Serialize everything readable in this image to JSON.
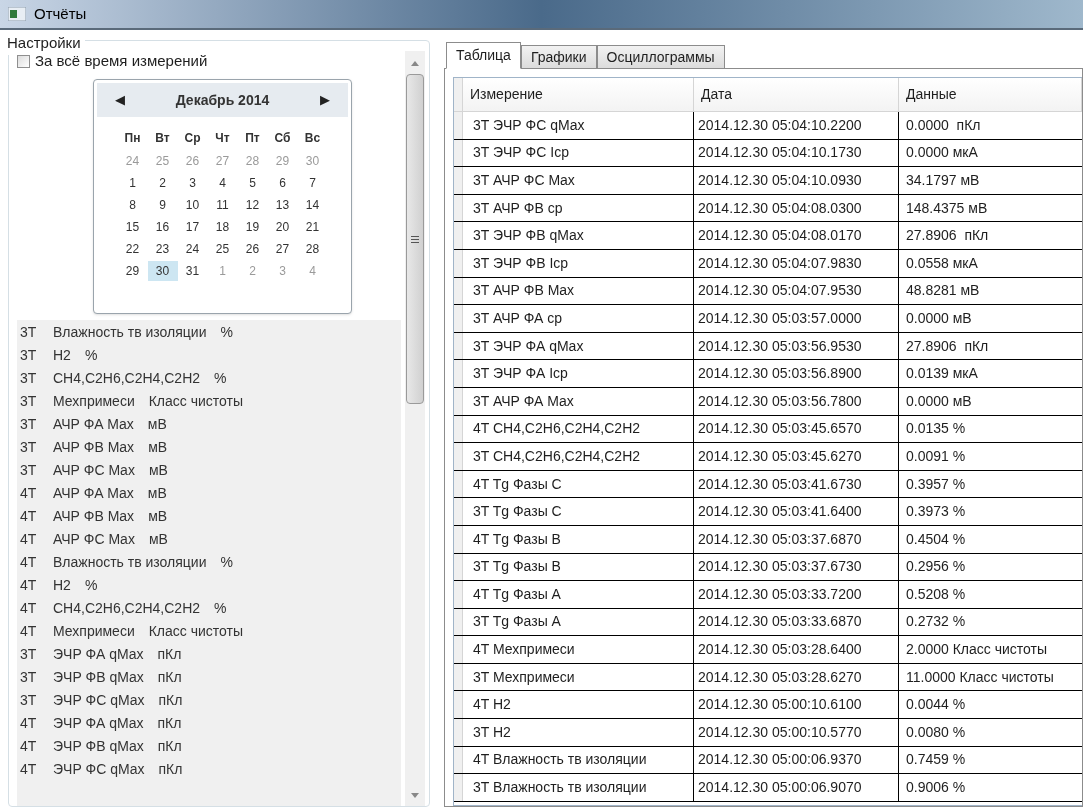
{
  "window": {
    "title": "Отчёты"
  },
  "settings": {
    "title": "Настройки",
    "all_time": {
      "label": "За всё время измерений",
      "checked": false
    },
    "calendar": {
      "month": "Декабрь 2014",
      "prev": "◀",
      "next": "▶",
      "weekdays": [
        "Пн",
        "Вт",
        "Ср",
        "Чт",
        "Пт",
        "Сб",
        "Вс"
      ],
      "weeks": [
        [
          {
            "d": "24",
            "other": true,
            "selected": false
          },
          {
            "d": "25",
            "other": true,
            "selected": false
          },
          {
            "d": "26",
            "other": true,
            "selected": false
          },
          {
            "d": "27",
            "other": true,
            "selected": false
          },
          {
            "d": "28",
            "other": true,
            "selected": false
          },
          {
            "d": "29",
            "other": true,
            "selected": false
          },
          {
            "d": "30",
            "other": true,
            "selected": false
          }
        ],
        [
          {
            "d": "1",
            "other": false,
            "selected": false
          },
          {
            "d": "2",
            "other": false,
            "selected": false
          },
          {
            "d": "3",
            "other": false,
            "selected": false
          },
          {
            "d": "4",
            "other": false,
            "selected": false
          },
          {
            "d": "5",
            "other": false,
            "selected": false
          },
          {
            "d": "6",
            "other": false,
            "selected": false
          },
          {
            "d": "7",
            "other": false,
            "selected": false
          }
        ],
        [
          {
            "d": "8",
            "other": false,
            "selected": false
          },
          {
            "d": "9",
            "other": false,
            "selected": false
          },
          {
            "d": "10",
            "other": false,
            "selected": false
          },
          {
            "d": "11",
            "other": false,
            "selected": false
          },
          {
            "d": "12",
            "other": false,
            "selected": false
          },
          {
            "d": "13",
            "other": false,
            "selected": false
          },
          {
            "d": "14",
            "other": false,
            "selected": false
          }
        ],
        [
          {
            "d": "15",
            "other": false,
            "selected": false
          },
          {
            "d": "16",
            "other": false,
            "selected": false
          },
          {
            "d": "17",
            "other": false,
            "selected": false
          },
          {
            "d": "18",
            "other": false,
            "selected": false
          },
          {
            "d": "19",
            "other": false,
            "selected": false
          },
          {
            "d": "20",
            "other": false,
            "selected": false
          },
          {
            "d": "21",
            "other": false,
            "selected": false
          }
        ],
        [
          {
            "d": "22",
            "other": false,
            "selected": false
          },
          {
            "d": "23",
            "other": false,
            "selected": false
          },
          {
            "d": "24",
            "other": false,
            "selected": false
          },
          {
            "d": "25",
            "other": false,
            "selected": false
          },
          {
            "d": "26",
            "other": false,
            "selected": false
          },
          {
            "d": "27",
            "other": false,
            "selected": false
          },
          {
            "d": "28",
            "other": false,
            "selected": false
          }
        ],
        [
          {
            "d": "29",
            "other": false,
            "selected": false
          },
          {
            "d": "30",
            "other": false,
            "selected": true
          },
          {
            "d": "31",
            "other": false,
            "selected": false
          },
          {
            "d": "1",
            "other": true,
            "selected": false
          },
          {
            "d": "2",
            "other": true,
            "selected": false
          },
          {
            "d": "3",
            "other": true,
            "selected": false
          },
          {
            "d": "4",
            "other": true,
            "selected": false
          }
        ]
      ]
    },
    "parameters": [
      {
        "unit_no": "3T",
        "name": "Влажность тв изоляции",
        "unit": "%"
      },
      {
        "unit_no": "3T",
        "name": "H2",
        "unit": "%"
      },
      {
        "unit_no": "3T",
        "name": "CH4,C2H6,C2H4,C2H2",
        "unit": "%"
      },
      {
        "unit_no": "3T",
        "name": "Мехпримеси",
        "unit": "Класс чистоты"
      },
      {
        "unit_no": "3T",
        "name": "АЧР ФА Max",
        "unit": "мВ"
      },
      {
        "unit_no": "3T",
        "name": "АЧР ФВ Max",
        "unit": "мВ"
      },
      {
        "unit_no": "3T",
        "name": "АЧР ФС Max",
        "unit": "мВ"
      },
      {
        "unit_no": "4T",
        "name": "АЧР ФА Max",
        "unit": "мВ"
      },
      {
        "unit_no": "4T",
        "name": "АЧР ФВ Max",
        "unit": "мВ"
      },
      {
        "unit_no": "4T",
        "name": "АЧР ФС Max",
        "unit": "мВ"
      },
      {
        "unit_no": "4T",
        "name": "Влажность тв изоляции",
        "unit": "%"
      },
      {
        "unit_no": "4T",
        "name": "H2",
        "unit": "%"
      },
      {
        "unit_no": "4T",
        "name": "CH4,C2H6,C2H4,C2H2",
        "unit": "%"
      },
      {
        "unit_no": "4T",
        "name": "Мехпримеси",
        "unit": "Класс чистоты"
      },
      {
        "unit_no": "3T",
        "name": "ЭЧР ФА qMax",
        "unit": "пКл"
      },
      {
        "unit_no": "3T",
        "name": "ЭЧР ФВ qMax",
        "unit": "пКл"
      },
      {
        "unit_no": "3T",
        "name": "ЭЧР ФС qMax",
        "unit": "пКл"
      },
      {
        "unit_no": "4T",
        "name": "ЭЧР ФА qMax",
        "unit": "пКл"
      },
      {
        "unit_no": "4T",
        "name": "ЭЧР ФВ qMax",
        "unit": "пКл"
      },
      {
        "unit_no": "4T",
        "name": "ЭЧР ФС qMax",
        "unit": "пКл"
      }
    ]
  },
  "tabs": [
    {
      "label": "Таблица",
      "selected": true
    },
    {
      "label": "Графики",
      "selected": false
    },
    {
      "label": "Осциллограммы",
      "selected": false
    }
  ],
  "table": {
    "columns": [
      "Измерение",
      "Дата",
      "Данные"
    ],
    "rows": [
      [
        "3T ЭЧР ФС qMax",
        "2014.12.30 05:04:10.2200",
        "0.0000  пКл"
      ],
      [
        "3T ЭЧР ФС Icp",
        "2014.12.30 05:04:10.1730",
        "0.0000 мкА"
      ],
      [
        "3T АЧР ФС Max",
        "2014.12.30 05:04:10.0930",
        "34.1797 мВ"
      ],
      [
        "3T АЧР ФВ ср",
        "2014.12.30 05:04:08.0300",
        "148.4375 мВ"
      ],
      [
        "3T ЭЧР ФВ qMax",
        "2014.12.30 05:04:08.0170",
        "27.8906  пКл"
      ],
      [
        "3T ЭЧР ФВ Icp",
        "2014.12.30 05:04:07.9830",
        "0.0558 мкА"
      ],
      [
        "3T АЧР ФВ Max",
        "2014.12.30 05:04:07.9530",
        "48.8281 мВ"
      ],
      [
        "3T АЧР ФА ср",
        "2014.12.30 05:03:57.0000",
        "0.0000 мВ"
      ],
      [
        "3T ЭЧР ФА qMax",
        "2014.12.30 05:03:56.9530",
        "27.8906  пКл"
      ],
      [
        "3T ЭЧР ФА Icp",
        "2014.12.30 05:03:56.8900",
        "0.0139 мкА"
      ],
      [
        "3T АЧР ФА Max",
        "2014.12.30 05:03:56.7800",
        "0.0000 мВ"
      ],
      [
        "4T CH4,C2H6,C2H4,C2H2",
        "2014.12.30 05:03:45.6570",
        "0.0135 %"
      ],
      [
        "3T CH4,C2H6,C2H4,C2H2",
        "2014.12.30 05:03:45.6270",
        "0.0091 %"
      ],
      [
        "4T Tg Фазы C",
        "2014.12.30 05:03:41.6730",
        "0.3957 %"
      ],
      [
        "3T Tg Фазы C",
        "2014.12.30 05:03:41.6400",
        "0.3973 %"
      ],
      [
        "4T Tg Фазы B",
        "2014.12.30 05:03:37.6870",
        "0.4504 %"
      ],
      [
        "3T Tg Фазы B",
        "2014.12.30 05:03:37.6730",
        "0.2956 %"
      ],
      [
        "4T Tg Фазы A",
        "2014.12.30 05:03:33.7200",
        "0.5208 %"
      ],
      [
        "3T Tg Фазы A",
        "2014.12.30 05:03:33.6870",
        "0.2732 %"
      ],
      [
        "4T Мехпримеси",
        "2014.12.30 05:03:28.6400",
        "2.0000 Класс чистоты"
      ],
      [
        "3T Мехпримеси",
        "2014.12.30 05:03:28.6270",
        "11.0000 Класс чистоты"
      ],
      [
        "4T H2",
        "2014.12.30 05:00:10.6100",
        "0.0044 %"
      ],
      [
        "3T H2",
        "2014.12.30 05:00:10.5770",
        "0.0080 %"
      ],
      [
        "4T Влажность тв изоляции",
        "2014.12.30 05:00:06.9370",
        "0.7459 %"
      ],
      [
        "3T Влажность тв изоляции",
        "2014.12.30 05:00:06.9070",
        "0.9006 %"
      ]
    ]
  }
}
